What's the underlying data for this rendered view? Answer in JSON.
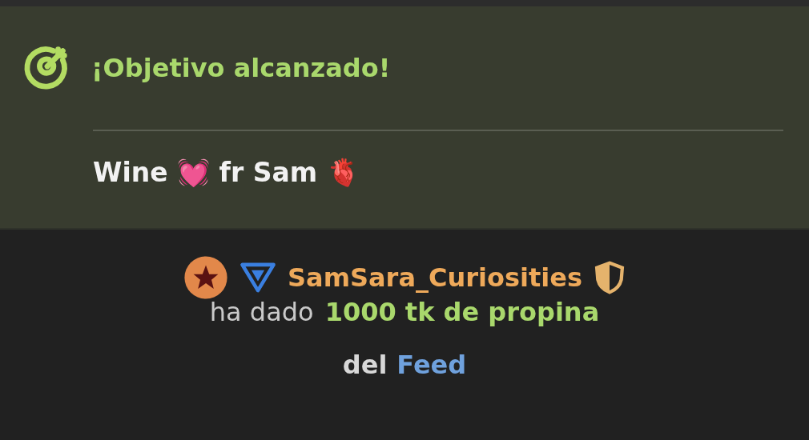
{
  "goal": {
    "title": "¡Objetivo alcanzado!",
    "message": "Wine 💓 fr Sam 🫀"
  },
  "tip": {
    "username": "SamSara_Curiosities",
    "action": "ha dado",
    "amount": "1000 tk de propina",
    "source_prefix": "del",
    "source": "Feed"
  }
}
